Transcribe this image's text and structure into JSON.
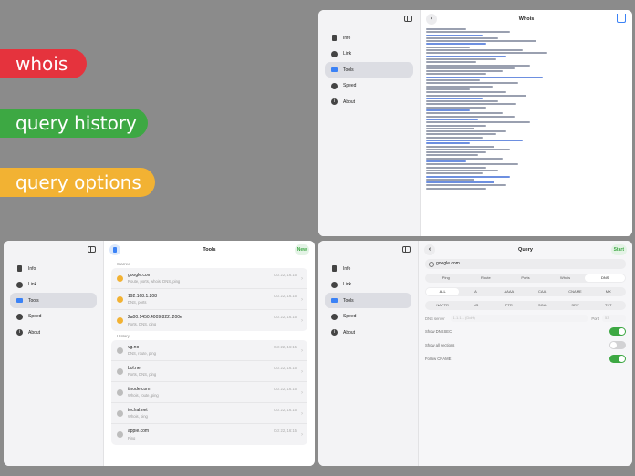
{
  "tags": [
    "whois",
    "query history",
    "query options"
  ],
  "sidebar": [
    {
      "label": "Info",
      "icon": "doc-icon"
    },
    {
      "label": "Link",
      "icon": "globe-icon"
    },
    {
      "label": "Tools",
      "icon": "briefcase-icon"
    },
    {
      "label": "Speed",
      "icon": "speedometer-icon"
    },
    {
      "label": "About",
      "icon": "info-icon"
    }
  ],
  "whois_panel": {
    "title": "Whois"
  },
  "tools_panel": {
    "title": "Tools",
    "action": "New",
    "starred_label": "Starred",
    "history_label": "History",
    "starred": [
      {
        "title": "google.com",
        "sub": "Route, ports, whois, DNS, ping",
        "date": "Oct 22, 16:15"
      },
      {
        "title": "192.168.1.208",
        "sub": "DNS, ports",
        "date": "Oct 22, 16:15"
      },
      {
        "title": "2a00:1450:4009:822::200e",
        "sub": "Ports, DNS, ping",
        "date": "Oct 22, 16:15"
      }
    ],
    "history": [
      {
        "title": "vg.no",
        "sub": "DNS, route, ping",
        "date": "Oct 22, 16:15"
      },
      {
        "title": "bol.net",
        "sub": "Ports, DNS, ping",
        "date": "Oct 22, 16:15"
      },
      {
        "title": "tinode.com",
        "sub": "Whois, route, ping",
        "date": "Oct 22, 16:15"
      },
      {
        "title": "techal.net",
        "sub": "Whois, ping",
        "date": "Oct 22, 16:15"
      },
      {
        "title": "apple.com",
        "sub": "Ping",
        "date": "Oct 22, 16:15"
      }
    ]
  },
  "query_panel": {
    "title": "Query",
    "action": "Start",
    "query_value": "google.com",
    "tools": [
      "Ping",
      "Route",
      "Ports",
      "Whois",
      "DNS"
    ],
    "tools_selected": "DNS",
    "record_types_1": [
      "ALL",
      "A",
      "AAAA",
      "CAA",
      "CNAME",
      "MX"
    ],
    "record_types_1_selected": "ALL",
    "record_types_2": [
      "NAPTR",
      "NS",
      "PTR",
      "SOA",
      "SRV",
      "TXT"
    ],
    "dns_server_label": "DNS server",
    "dns_server_placeholder": "1.1.1.1 (DoH)",
    "port_label": "Port",
    "port_placeholder": "53",
    "options": [
      {
        "label": "Show DNSSEC",
        "on": true
      },
      {
        "label": "Show all sections",
        "on": false
      },
      {
        "label": "Follow CNAME",
        "on": true
      }
    ]
  }
}
